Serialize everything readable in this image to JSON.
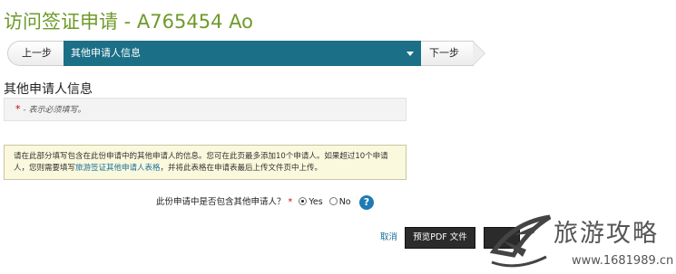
{
  "header": {
    "title": "访问签证申请 - A765454 Ao"
  },
  "stepbar": {
    "prev_label": "上一步",
    "current_label": "其他申请人信息",
    "next_label": "下一步"
  },
  "section": {
    "heading": "其他申请人信息",
    "required_star": "*",
    "required_note": "- 表示必须填写。"
  },
  "info": {
    "text_before": "请在此部分填写包含在此份申请中的其他申请人的信息。您可在此页最多添加10个申请人。如果超过10个申请人，您则需要填写",
    "link_text": "旅游签证其他申请人表格",
    "text_after": "，并将此表格在申请表最后上传文件页中上传。"
  },
  "question": {
    "label": "此份申请中是否包含其他申请人？",
    "star": "*",
    "options": [
      {
        "label": "Yes",
        "selected": true
      },
      {
        "label": "No",
        "selected": false
      }
    ],
    "help_glyph": "?"
  },
  "actions": {
    "cancel_label": "取消",
    "preview_label": "预览PDF 文件"
  },
  "watermark": {
    "brand": "旅游攻略",
    "url": "www.1681989.cn"
  },
  "colors": {
    "title": "#6e9a2a",
    "step_active": "#1b6f86",
    "link": "#1b6f9c",
    "info_bg": "#fbf9dd"
  },
  "icons": [
    "chevron-down-icon",
    "help-icon",
    "plane-icon"
  ]
}
